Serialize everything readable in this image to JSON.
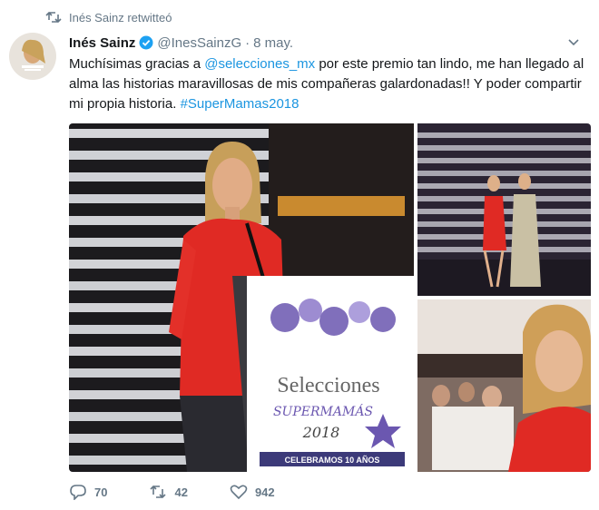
{
  "retweet": {
    "label": "Inés Sainz retwitteó"
  },
  "tweet": {
    "author_name": "Inés Sainz",
    "handle": "@InesSainzG",
    "separator": "·",
    "date": "8 may.",
    "text_part1": "Muchísimas gracias a ",
    "mention": "@selecciones_mx",
    "text_part2": " por este premio tan lindo, me han llegado al alma las historias maravillosas de mis compañeras galardonadas!! Y poder compartir mi propia historia. ",
    "hashtag": "#SuperMamas2018"
  },
  "media": {
    "podium_brand": "Selecciones",
    "podium_sub": "SUPERMAMÁS",
    "podium_year": "2018",
    "podium_banner": "CELEBRAMOS 10 AÑOS"
  },
  "actions": {
    "replies": "70",
    "retweets": "42",
    "likes": "942"
  },
  "colors": {
    "link": "#1b95e0",
    "secondary": "#657786",
    "retweet_icon": "#657786",
    "verified": "#1da1f2"
  },
  "icons": [
    "retweet-icon",
    "verified-icon",
    "chevron-down-icon",
    "reply-icon",
    "like-icon"
  ]
}
